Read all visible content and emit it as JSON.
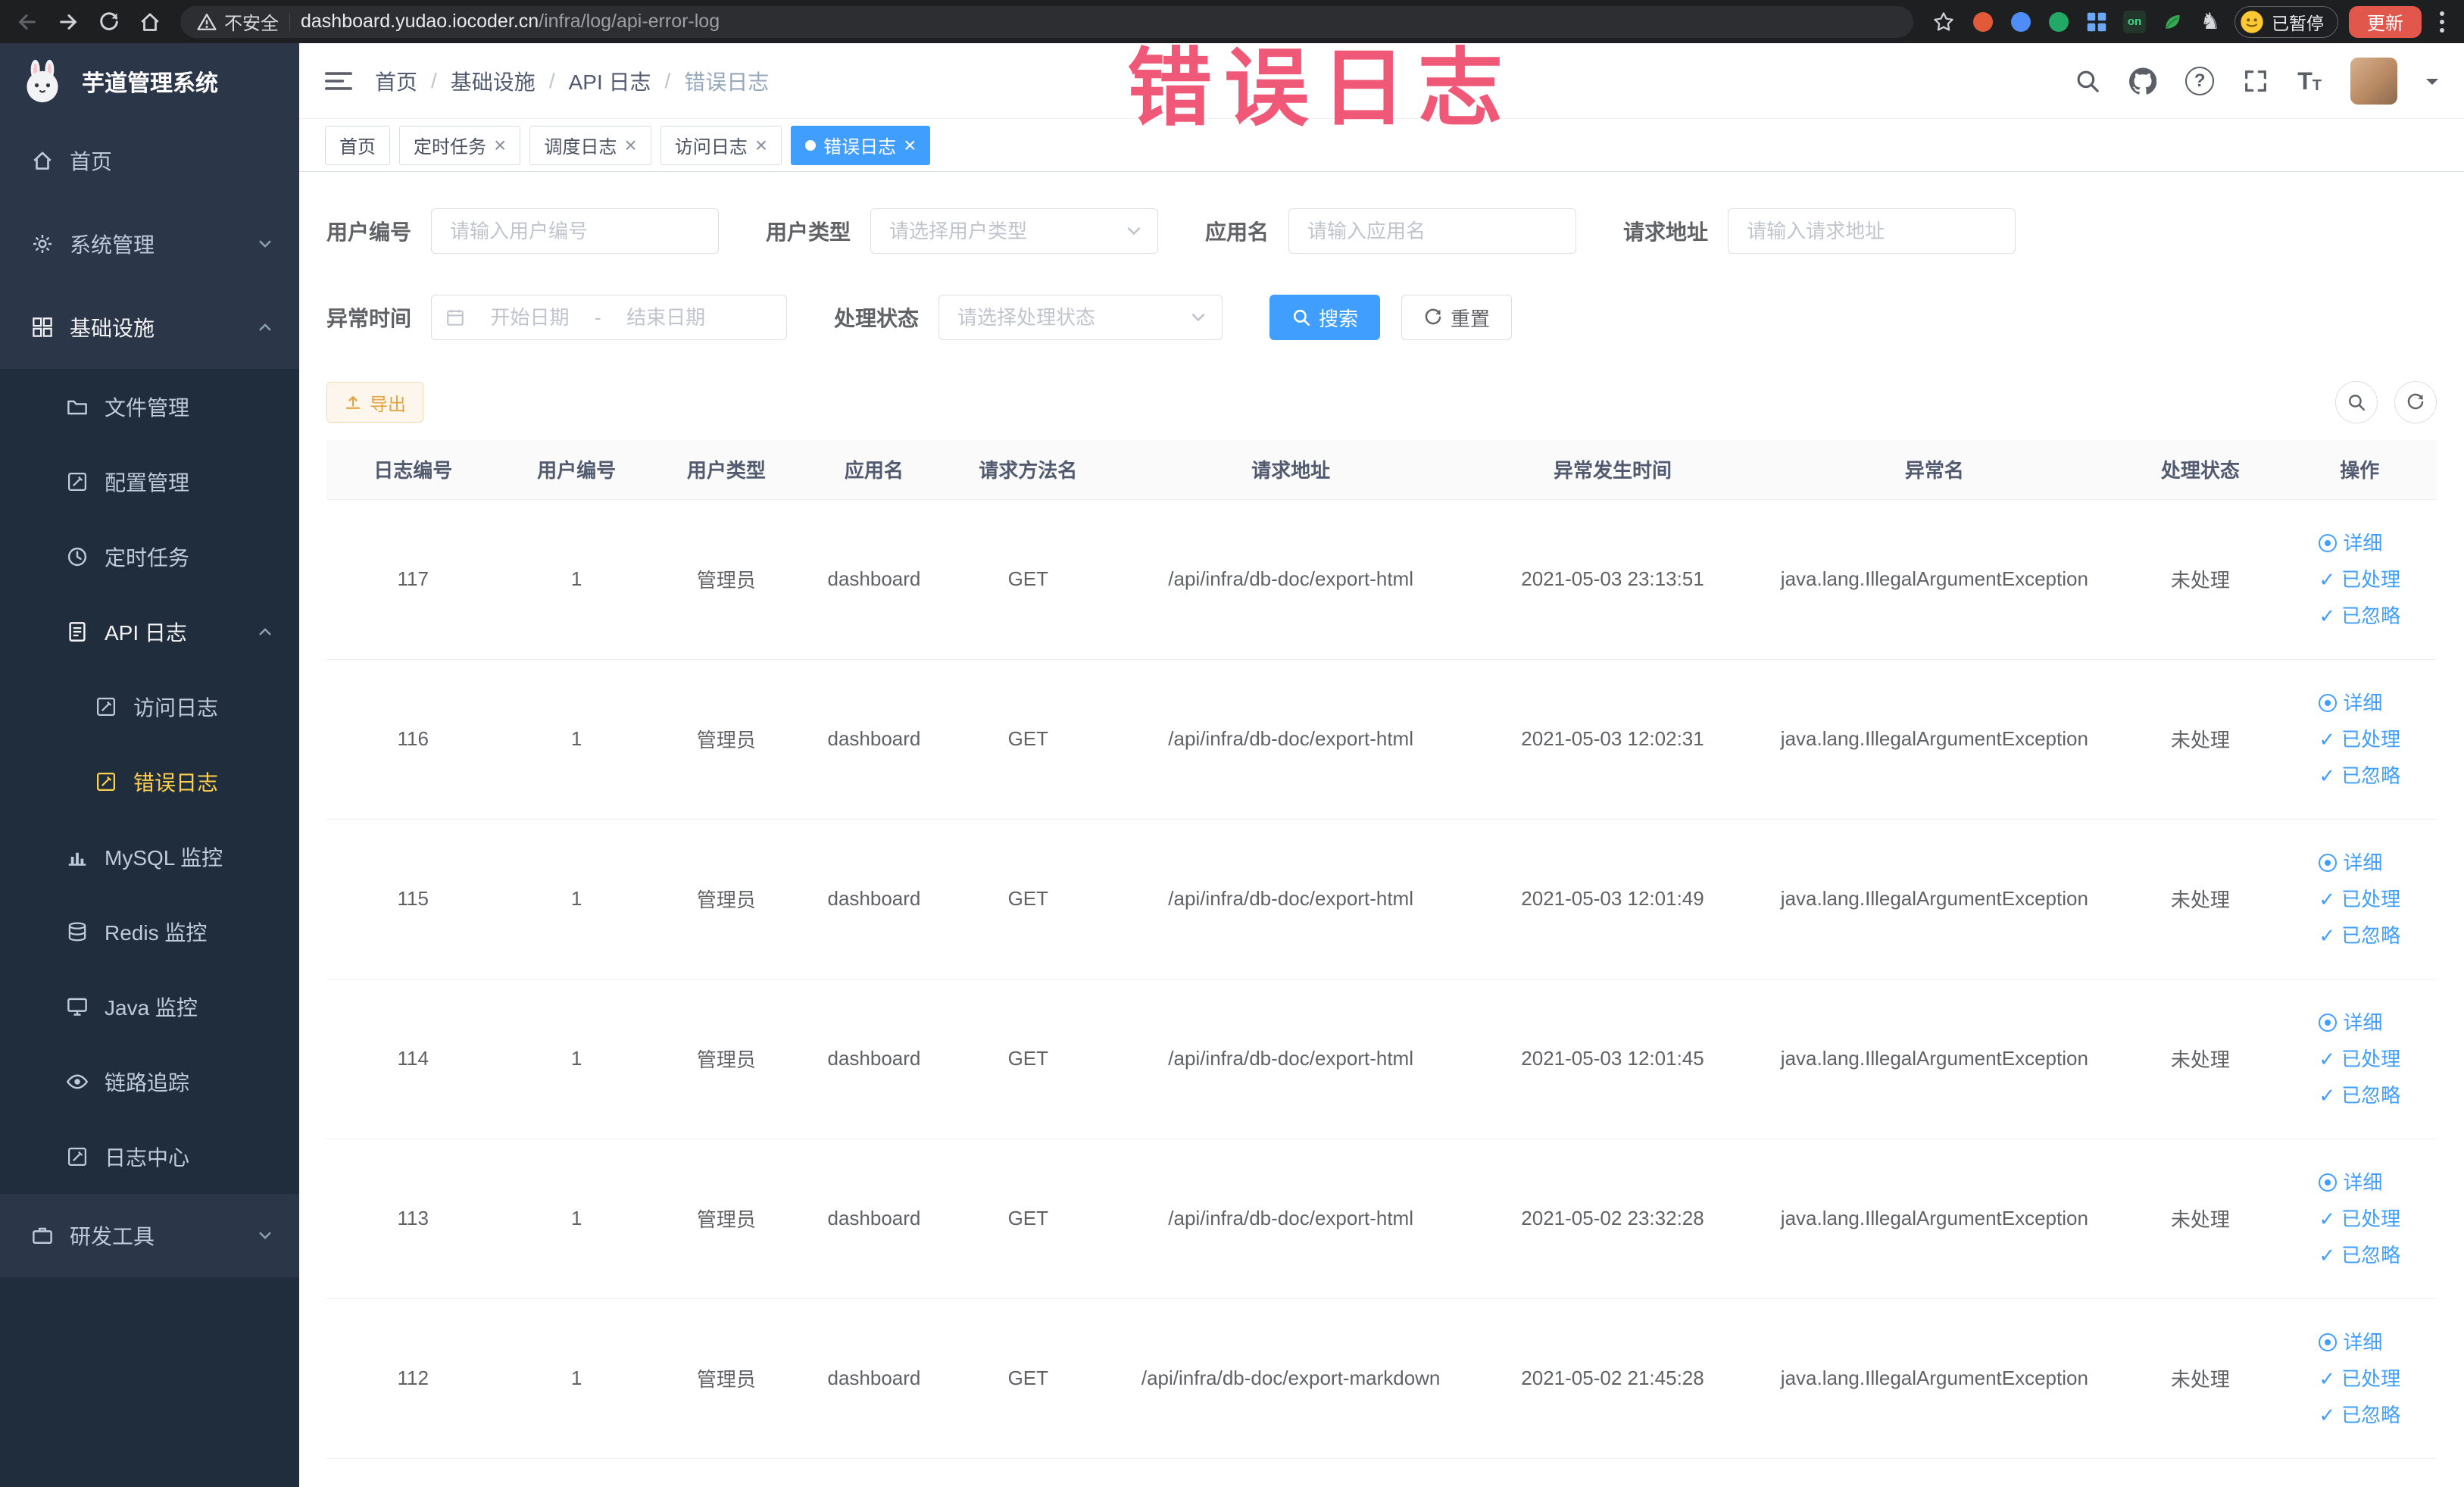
{
  "annotation": {
    "text": "错误日志"
  },
  "browser": {
    "security_label": "不安全",
    "url_host": "dashboard.yudao.iocoder.cn",
    "url_path": "/infra/log/api-error-log",
    "paused_badge": "已暂停",
    "update_button": "更新"
  },
  "sidebar": {
    "app_title": "芋道管理系统",
    "items": [
      {
        "label": "首页"
      },
      {
        "label": "系统管理"
      },
      {
        "label": "基础设施"
      },
      {
        "label": "文件管理"
      },
      {
        "label": "配置管理"
      },
      {
        "label": "定时任务"
      },
      {
        "label": "API 日志"
      },
      {
        "label": "访问日志"
      },
      {
        "label": "错误日志"
      },
      {
        "label": "MySQL 监控"
      },
      {
        "label": "Redis 监控"
      },
      {
        "label": "Java 监控"
      },
      {
        "label": "链路追踪"
      },
      {
        "label": "日志中心"
      },
      {
        "label": "研发工具"
      }
    ]
  },
  "header": {
    "breadcrumb": [
      "首页",
      "基础设施",
      "API 日志",
      "错误日志"
    ]
  },
  "tabs": [
    {
      "label": "首页"
    },
    {
      "label": "定时任务"
    },
    {
      "label": "调度日志"
    },
    {
      "label": "访问日志"
    },
    {
      "label": "错误日志"
    }
  ],
  "filters": {
    "user_id_label": "用户编号",
    "user_id_placeholder": "请输入用户编号",
    "user_type_label": "用户类型",
    "user_type_placeholder": "请选择用户类型",
    "app_name_label": "应用名",
    "app_name_placeholder": "请输入应用名",
    "request_url_label": "请求地址",
    "request_url_placeholder": "请输入请求地址",
    "exception_time_label": "异常时间",
    "date_start_placeholder": "开始日期",
    "date_separator": "-",
    "date_end_placeholder": "结束日期",
    "process_status_label": "处理状态",
    "process_status_placeholder": "请选择处理状态",
    "search_button": "搜索",
    "reset_button": "重置"
  },
  "toolbar": {
    "export_button": "导出"
  },
  "table": {
    "columns": [
      "日志编号",
      "用户编号",
      "用户类型",
      "应用名",
      "请求方法名",
      "请求地址",
      "异常发生时间",
      "异常名",
      "处理状态",
      "操作"
    ],
    "actions": [
      "详细",
      "已处理",
      "已忽略"
    ],
    "rows": [
      {
        "id": "117",
        "user_id": "1",
        "user_type": "管理员",
        "app": "dashboard",
        "method": "GET",
        "url": "/api/infra/db-doc/export-html",
        "time": "2021-05-03 23:13:51",
        "exception": "java.lang.IllegalArgumentException",
        "status": "未处理"
      },
      {
        "id": "116",
        "user_id": "1",
        "user_type": "管理员",
        "app": "dashboard",
        "method": "GET",
        "url": "/api/infra/db-doc/export-html",
        "time": "2021-05-03 12:02:31",
        "exception": "java.lang.IllegalArgumentException",
        "status": "未处理"
      },
      {
        "id": "115",
        "user_id": "1",
        "user_type": "管理员",
        "app": "dashboard",
        "method": "GET",
        "url": "/api/infra/db-doc/export-html",
        "time": "2021-05-03 12:01:49",
        "exception": "java.lang.IllegalArgumentException",
        "status": "未处理"
      },
      {
        "id": "114",
        "user_id": "1",
        "user_type": "管理员",
        "app": "dashboard",
        "method": "GET",
        "url": "/api/infra/db-doc/export-html",
        "time": "2021-05-03 12:01:45",
        "exception": "java.lang.IllegalArgumentException",
        "status": "未处理"
      },
      {
        "id": "113",
        "user_id": "1",
        "user_type": "管理员",
        "app": "dashboard",
        "method": "GET",
        "url": "/api/infra/db-doc/export-html",
        "time": "2021-05-02 23:32:28",
        "exception": "java.lang.IllegalArgumentException",
        "status": "未处理"
      },
      {
        "id": "112",
        "user_id": "1",
        "user_type": "管理员",
        "app": "dashboard",
        "method": "GET",
        "url": "/api/infra/db-doc/export-markdown",
        "time": "2021-05-02 21:45:28",
        "exception": "java.lang.IllegalArgumentException",
        "status": "未处理"
      }
    ]
  }
}
